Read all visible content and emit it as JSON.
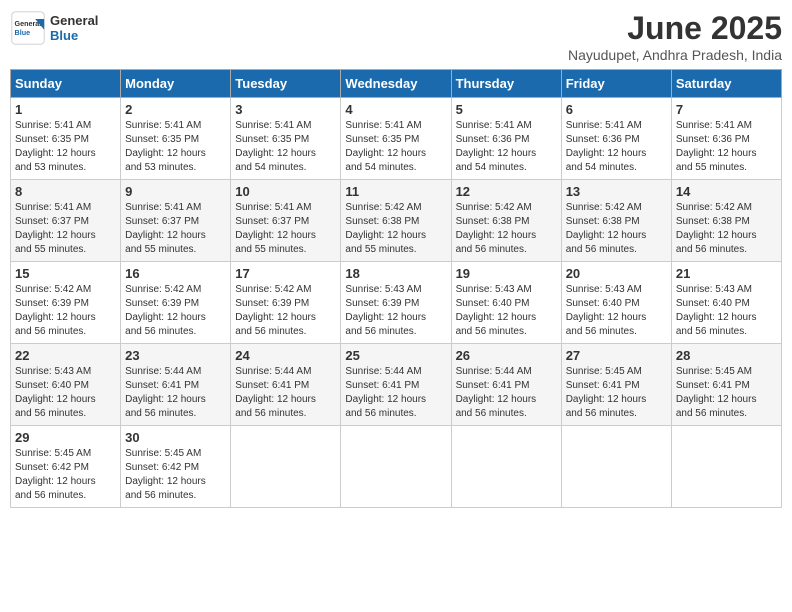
{
  "header": {
    "logo_general": "General",
    "logo_blue": "Blue",
    "main_title": "June 2025",
    "sub_title": "Nayudupet, Andhra Pradesh, India"
  },
  "calendar": {
    "days_of_week": [
      "Sunday",
      "Monday",
      "Tuesday",
      "Wednesday",
      "Thursday",
      "Friday",
      "Saturday"
    ],
    "weeks": [
      [
        {
          "day": "",
          "info": ""
        },
        {
          "day": "2",
          "info": "Sunrise: 5:41 AM\nSunset: 6:35 PM\nDaylight: 12 hours\nand 53 minutes."
        },
        {
          "day": "3",
          "info": "Sunrise: 5:41 AM\nSunset: 6:35 PM\nDaylight: 12 hours\nand 54 minutes."
        },
        {
          "day": "4",
          "info": "Sunrise: 5:41 AM\nSunset: 6:35 PM\nDaylight: 12 hours\nand 54 minutes."
        },
        {
          "day": "5",
          "info": "Sunrise: 5:41 AM\nSunset: 6:36 PM\nDaylight: 12 hours\nand 54 minutes."
        },
        {
          "day": "6",
          "info": "Sunrise: 5:41 AM\nSunset: 6:36 PM\nDaylight: 12 hours\nand 54 minutes."
        },
        {
          "day": "7",
          "info": "Sunrise: 5:41 AM\nSunset: 6:36 PM\nDaylight: 12 hours\nand 55 minutes."
        }
      ],
      [
        {
          "day": "1",
          "info": "Sunrise: 5:41 AM\nSunset: 6:35 PM\nDaylight: 12 hours\nand 53 minutes."
        },
        {
          "day": "9",
          "info": "Sunrise: 5:41 AM\nSunset: 6:37 PM\nDaylight: 12 hours\nand 55 minutes."
        },
        {
          "day": "10",
          "info": "Sunrise: 5:41 AM\nSunset: 6:37 PM\nDaylight: 12 hours\nand 55 minutes."
        },
        {
          "day": "11",
          "info": "Sunrise: 5:42 AM\nSunset: 6:38 PM\nDaylight: 12 hours\nand 55 minutes."
        },
        {
          "day": "12",
          "info": "Sunrise: 5:42 AM\nSunset: 6:38 PM\nDaylight: 12 hours\nand 56 minutes."
        },
        {
          "day": "13",
          "info": "Sunrise: 5:42 AM\nSunset: 6:38 PM\nDaylight: 12 hours\nand 56 minutes."
        },
        {
          "day": "14",
          "info": "Sunrise: 5:42 AM\nSunset: 6:38 PM\nDaylight: 12 hours\nand 56 minutes."
        }
      ],
      [
        {
          "day": "8",
          "info": "Sunrise: 5:41 AM\nSunset: 6:37 PM\nDaylight: 12 hours\nand 55 minutes."
        },
        {
          "day": "16",
          "info": "Sunrise: 5:42 AM\nSunset: 6:39 PM\nDaylight: 12 hours\nand 56 minutes."
        },
        {
          "day": "17",
          "info": "Sunrise: 5:42 AM\nSunset: 6:39 PM\nDaylight: 12 hours\nand 56 minutes."
        },
        {
          "day": "18",
          "info": "Sunrise: 5:43 AM\nSunset: 6:39 PM\nDaylight: 12 hours\nand 56 minutes."
        },
        {
          "day": "19",
          "info": "Sunrise: 5:43 AM\nSunset: 6:40 PM\nDaylight: 12 hours\nand 56 minutes."
        },
        {
          "day": "20",
          "info": "Sunrise: 5:43 AM\nSunset: 6:40 PM\nDaylight: 12 hours\nand 56 minutes."
        },
        {
          "day": "21",
          "info": "Sunrise: 5:43 AM\nSunset: 6:40 PM\nDaylight: 12 hours\nand 56 minutes."
        }
      ],
      [
        {
          "day": "15",
          "info": "Sunrise: 5:42 AM\nSunset: 6:39 PM\nDaylight: 12 hours\nand 56 minutes."
        },
        {
          "day": "23",
          "info": "Sunrise: 5:44 AM\nSunset: 6:41 PM\nDaylight: 12 hours\nand 56 minutes."
        },
        {
          "day": "24",
          "info": "Sunrise: 5:44 AM\nSunset: 6:41 PM\nDaylight: 12 hours\nand 56 minutes."
        },
        {
          "day": "25",
          "info": "Sunrise: 5:44 AM\nSunset: 6:41 PM\nDaylight: 12 hours\nand 56 minutes."
        },
        {
          "day": "26",
          "info": "Sunrise: 5:44 AM\nSunset: 6:41 PM\nDaylight: 12 hours\nand 56 minutes."
        },
        {
          "day": "27",
          "info": "Sunrise: 5:45 AM\nSunset: 6:41 PM\nDaylight: 12 hours\nand 56 minutes."
        },
        {
          "day": "28",
          "info": "Sunrise: 5:45 AM\nSunset: 6:41 PM\nDaylight: 12 hours\nand 56 minutes."
        }
      ],
      [
        {
          "day": "22",
          "info": "Sunrise: 5:43 AM\nSunset: 6:40 PM\nDaylight: 12 hours\nand 56 minutes."
        },
        {
          "day": "30",
          "info": "Sunrise: 5:45 AM\nSunset: 6:42 PM\nDaylight: 12 hours\nand 56 minutes."
        },
        {
          "day": "",
          "info": ""
        },
        {
          "day": "",
          "info": ""
        },
        {
          "day": "",
          "info": ""
        },
        {
          "day": "",
          "info": ""
        },
        {
          "day": "",
          "info": ""
        }
      ],
      [
        {
          "day": "29",
          "info": "Sunrise: 5:45 AM\nSunset: 6:42 PM\nDaylight: 12 hours\nand 56 minutes."
        },
        {
          "day": "",
          "info": ""
        },
        {
          "day": "",
          "info": ""
        },
        {
          "day": "",
          "info": ""
        },
        {
          "day": "",
          "info": ""
        },
        {
          "day": "",
          "info": ""
        },
        {
          "day": "",
          "info": ""
        }
      ]
    ]
  }
}
